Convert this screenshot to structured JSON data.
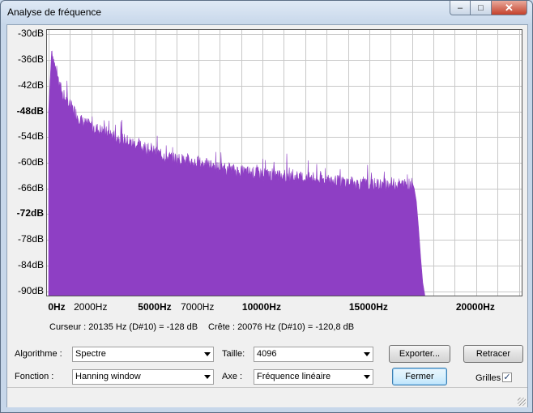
{
  "window": {
    "title": "Analyse de fréquence",
    "minimize_glyph": "–",
    "maximize_glyph": "□",
    "close_glyph": "✕"
  },
  "chart_data": {
    "type": "area",
    "title": "",
    "xlabel": "",
    "ylabel": "",
    "xlim": [
      0,
      22050
    ],
    "ylim": [
      -91,
      -29
    ],
    "grid": true,
    "fill_color": "#8e3fc4",
    "y_ticks": [
      {
        "value": -30,
        "label": "-30dB",
        "bold": false
      },
      {
        "value": -36,
        "label": "-36dB",
        "bold": false
      },
      {
        "value": -42,
        "label": "-42dB",
        "bold": false
      },
      {
        "value": -48,
        "label": "-48dB",
        "bold": true
      },
      {
        "value": -54,
        "label": "-54dB",
        "bold": false
      },
      {
        "value": -60,
        "label": "-60dB",
        "bold": false
      },
      {
        "value": -66,
        "label": "-66dB",
        "bold": false
      },
      {
        "value": -72,
        "label": "-72dB",
        "bold": true
      },
      {
        "value": -78,
        "label": "-78dB",
        "bold": false
      },
      {
        "value": -84,
        "label": "-84dB",
        "bold": false
      },
      {
        "value": -90,
        "label": "-90dB",
        "bold": false
      }
    ],
    "x_ticks": [
      {
        "value": 0,
        "label": "0Hz",
        "bold": true
      },
      {
        "value": 2000,
        "label": "2000Hz",
        "bold": false
      },
      {
        "value": 5000,
        "label": "5000Hz",
        "bold": true
      },
      {
        "value": 7000,
        "label": "7000Hz",
        "bold": false
      },
      {
        "value": 10000,
        "label": "10000Hz",
        "bold": true
      },
      {
        "value": 15000,
        "label": "15000Hz",
        "bold": true
      },
      {
        "value": 20000,
        "label": "20000Hz",
        "bold": true
      }
    ],
    "x": [
      0,
      150,
      300,
      500,
      700,
      1000,
      1300,
      1600,
      2000,
      2500,
      3000,
      3500,
      4000,
      4500,
      5000,
      5500,
      6000,
      6500,
      7000,
      8000,
      9000,
      10000,
      11000,
      12000,
      13000,
      14000,
      15000,
      16000,
      17000,
      17100,
      17200,
      17300,
      17400,
      17500,
      17600
    ],
    "y": [
      -48,
      -33,
      -37,
      -41,
      -44,
      -46,
      -48,
      -50,
      -51,
      -52,
      -53,
      -54,
      -55,
      -56,
      -57,
      -58,
      -58.5,
      -59,
      -59.5,
      -60.5,
      -61.5,
      -62,
      -62.5,
      -63,
      -63.5,
      -64,
      -64.5,
      -64.5,
      -64.5,
      -66,
      -69,
      -75,
      -82,
      -88,
      -91
    ]
  },
  "info": {
    "cursor": "Curseur : 20135 Hz (D#10) = -128 dB",
    "peak": "Crête : 20076 Hz (D#10) = -120,8 dB"
  },
  "controls": {
    "algorithm_label": "Algorithme :",
    "algorithm_value": "Spectre",
    "size_label": "Taille:",
    "size_value": "4096",
    "function_label": "Fonction :",
    "function_value": "Hanning window",
    "axis_label": "Axe :",
    "axis_value": "Fréquence linéaire",
    "export_button": "Exporter...",
    "replot_button": "Retracer",
    "close_button": "Fermer",
    "grids_label": "Grilles",
    "grids_checked": true,
    "check_glyph": "✓"
  }
}
